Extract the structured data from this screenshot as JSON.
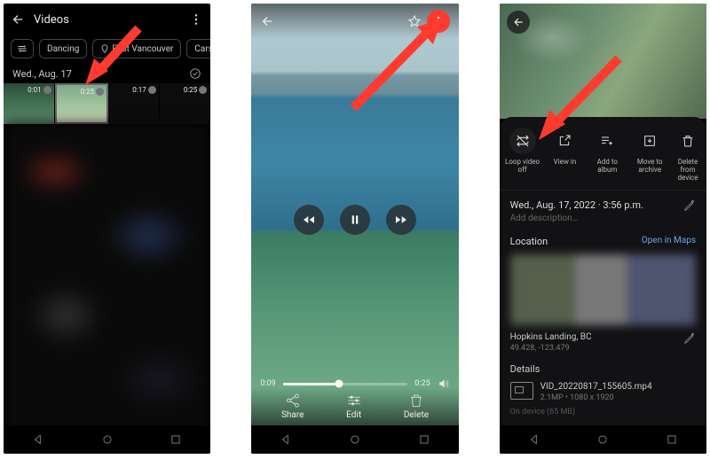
{
  "panel1": {
    "title": "Videos",
    "chips": [
      "Dancing",
      "East Vancouver",
      "Cars"
    ],
    "date_header": "Wed., Aug. 17",
    "thumbs": [
      {
        "duration": "0:01"
      },
      {
        "duration": "0:25"
      },
      {
        "duration": "0:17"
      },
      {
        "duration": "0:25"
      }
    ]
  },
  "panel2": {
    "scrub": {
      "current": "0:09",
      "total": "0:25"
    },
    "actions": {
      "share": "Share",
      "edit": "Edit",
      "delete": "Delete"
    }
  },
  "panel3": {
    "sheet_actions": {
      "loop": "Loop video off",
      "view": "View in",
      "album": "Add to album",
      "archive": "Move to archive",
      "delete": "Delete from device"
    },
    "date": "Wed., Aug. 17, 2022",
    "time": "3:56 p.m.",
    "desc_placeholder": "Add description…",
    "location_label": "Location",
    "open_maps": "Open in Maps",
    "place": "Hopkins Landing, BC",
    "coords": "49.428, -123.479",
    "details_label": "Details",
    "filename": "VID_20220817_155605.mp4",
    "filemeta": "2.1MP  •  1080 x 1920",
    "device_storage": "On device (65 MB)"
  }
}
